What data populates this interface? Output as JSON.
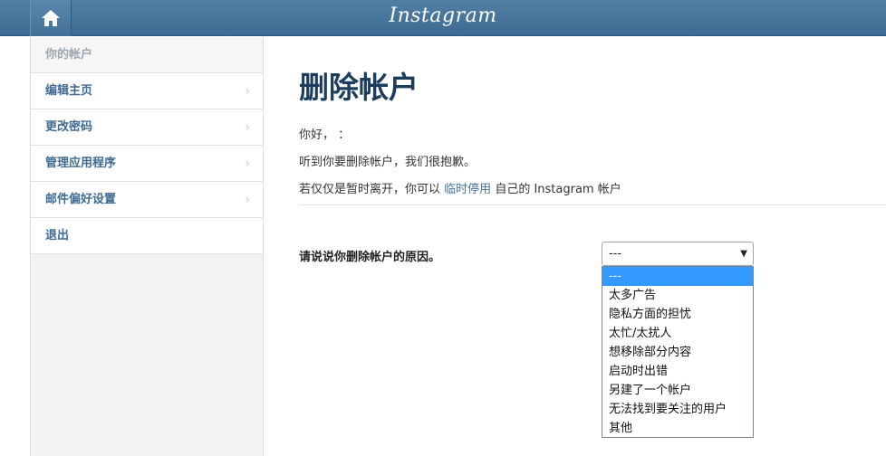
{
  "header": {
    "logo_text": "Instagram",
    "home_icon": "home-icon"
  },
  "sidebar": {
    "items": [
      {
        "label": "你的帐户",
        "current": true
      },
      {
        "label": "编辑主页"
      },
      {
        "label": "更改密码"
      },
      {
        "label": "管理应用程序"
      },
      {
        "label": "邮件偏好设置"
      },
      {
        "label": "退出"
      }
    ],
    "chevron": "›"
  },
  "main": {
    "title": "删除帐户",
    "greeting": "你好，          ：",
    "sorry": "听到你要删除帐户，我们很抱歉。",
    "temp_prefix": "若仅仅是暂时离开，你可以",
    "temp_link": "临时停用",
    "temp_suffix": "自己的 Instagram 帐户",
    "reason_label": "请说说你删除帐户的原因。"
  },
  "select": {
    "value": "---",
    "arrow": "▼",
    "options": [
      "---",
      "太多广告",
      "隐私方面的担忧",
      "太忙/太扰人",
      "想移除部分内容",
      "启动时出错",
      "另建了一个帐户",
      "无法找到要关注的用户",
      "其他"
    ]
  },
  "colors": {
    "header": "#517fa4",
    "link": "#3f729b",
    "title": "#1c3d5e",
    "selected_option": "#3399ff"
  }
}
